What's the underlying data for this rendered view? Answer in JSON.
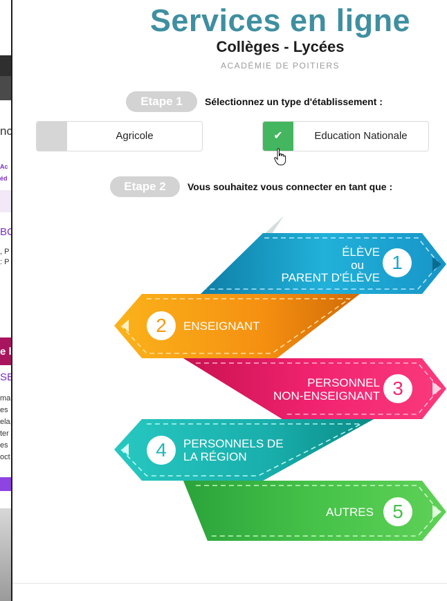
{
  "background": {
    "fragments": [
      "nc",
      "Ac",
      "éd",
      "BC",
      ", P",
      ": P",
      "e b",
      "SE",
      "man",
      "es",
      "ela,",
      "ter",
      "es",
      "oct"
    ]
  },
  "header": {
    "title": "Services en ligne",
    "subtitle": "Collèges - Lycées",
    "academie": "ACADÉMIE DE POITIERS"
  },
  "step1": {
    "pill": "Etape 1",
    "prompt": "Sélectionnez un type d'établissement :",
    "options": [
      {
        "label": "Agricole",
        "selected": false
      },
      {
        "label": "Education Nationale",
        "selected": true,
        "check": "✔"
      }
    ]
  },
  "step2": {
    "pill": "Etape 2",
    "prompt": "Vous souhaitez vous connecter en tant que :"
  },
  "profiles": [
    {
      "number": "1",
      "line1": "ÉLÈVE",
      "ou": "ou",
      "line2": "PARENT D'ÉLÈVE",
      "color": "#1ba4cf"
    },
    {
      "number": "2",
      "line1": "ENSEIGNANT",
      "color": "#f59a0c"
    },
    {
      "number": "3",
      "line1": "PERSONNEL",
      "line2": "NON-ENSEIGNANT",
      "color": "#f22a72"
    },
    {
      "number": "4",
      "line1": "PERSONNELS DE",
      "line2": "LA RÉGION",
      "color": "#1cb8b4"
    },
    {
      "number": "5",
      "line1": "AUTRES",
      "color": "#45c04a"
    }
  ]
}
